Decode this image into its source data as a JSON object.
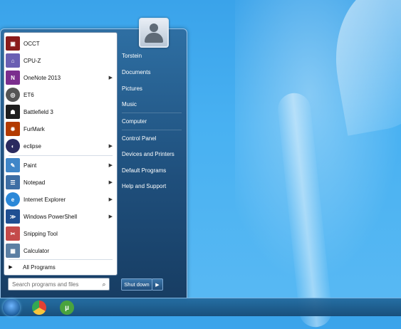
{
  "start_menu": {
    "programs": [
      {
        "label": "OCCT",
        "icon": "occt-icon",
        "color": "#8a1b1b",
        "arrow": false
      },
      {
        "label": "CPU-Z",
        "icon": "cpuz-icon",
        "color": "#6a5fb3",
        "arrow": false
      },
      {
        "label": "OneNote 2013",
        "icon": "onenote-icon",
        "color": "#7b2e8e",
        "arrow": true
      },
      {
        "label": "ET6",
        "icon": "et6-icon",
        "color": "#555555",
        "arrow": false
      },
      {
        "label": "Battlefield 3",
        "icon": "battlefield-icon",
        "color": "#1d1d1d",
        "arrow": false
      },
      {
        "label": "FurMark",
        "icon": "furmark-icon",
        "color": "#b33a00",
        "arrow": false
      },
      {
        "label": "eclipse",
        "icon": "eclipse-icon",
        "color": "#2b2b5f",
        "arrow": true
      },
      {
        "label": "Paint",
        "icon": "paint-icon",
        "color": "#3f86c8",
        "arrow": true
      },
      {
        "label": "Notepad",
        "icon": "notepad-icon",
        "color": "#3d6ea4",
        "arrow": true
      },
      {
        "label": "Internet Explorer",
        "icon": "ie-icon",
        "color": "#2b88d8",
        "arrow": true
      },
      {
        "label": "Windows PowerShell",
        "icon": "powershell-icon",
        "color": "#1f4f92",
        "arrow": true
      },
      {
        "label": "Snipping Tool",
        "icon": "snipping-icon",
        "color": "#c44a4a",
        "arrow": false
      },
      {
        "label": "Calculator",
        "icon": "calculator-icon",
        "color": "#5b7fa3",
        "arrow": false
      }
    ],
    "all_programs": "All Programs",
    "search_placeholder": "Search programs and files",
    "right_items": [
      "Torstein",
      "Documents",
      "Pictures",
      "Music",
      "Computer",
      "Control Panel",
      "Devices and Printers",
      "Default Programs",
      "Help and Support"
    ],
    "shutdown": "Shut down"
  },
  "taskbar": {
    "icons": [
      {
        "name": "start-orb"
      },
      {
        "name": "chrome-icon"
      },
      {
        "name": "utorrent-icon"
      }
    ]
  }
}
